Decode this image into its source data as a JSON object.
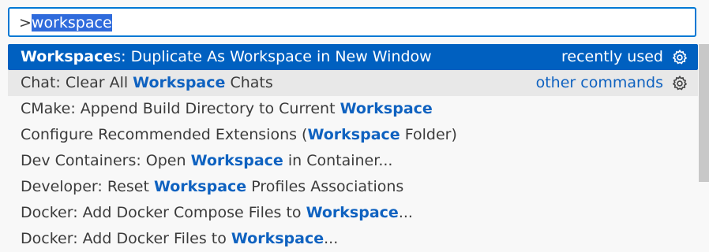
{
  "search": {
    "prefix": ">",
    "query": "workspace"
  },
  "rows": [
    {
      "before": "",
      "highlight": "Workspace",
      "after": "s: Duplicate As Workspace in New Window",
      "right_label": "recently used",
      "state": "selected"
    },
    {
      "before": "Chat: Clear All ",
      "highlight": "Workspace",
      "after": " Chats",
      "right_label": "other commands",
      "state": "hover"
    },
    {
      "before": "CMake: Append Build Directory to Current ",
      "highlight": "Workspace",
      "after": "",
      "state": "normal"
    },
    {
      "before": "Configure Recommended Extensions (",
      "highlight": "Workspace",
      "after": " Folder)",
      "state": "normal"
    },
    {
      "before": "Dev Containers: Open ",
      "highlight": "Workspace",
      "after": " in Container...",
      "state": "normal"
    },
    {
      "before": "Developer: Reset ",
      "highlight": "Workspace",
      "after": " Profiles Associations",
      "state": "normal"
    },
    {
      "before": "Docker: Add Docker Compose Files to ",
      "highlight": "Workspace",
      "after": "...",
      "state": "normal"
    },
    {
      "before": "Docker: Add Docker Files to ",
      "highlight": "Workspace",
      "after": "...",
      "state": "normal"
    }
  ],
  "icons": {
    "row_action": "gear-icon"
  },
  "colors": {
    "accent": "#0060c0",
    "highlight_text": "#0f62c0",
    "focus_border": "#0078d4"
  }
}
